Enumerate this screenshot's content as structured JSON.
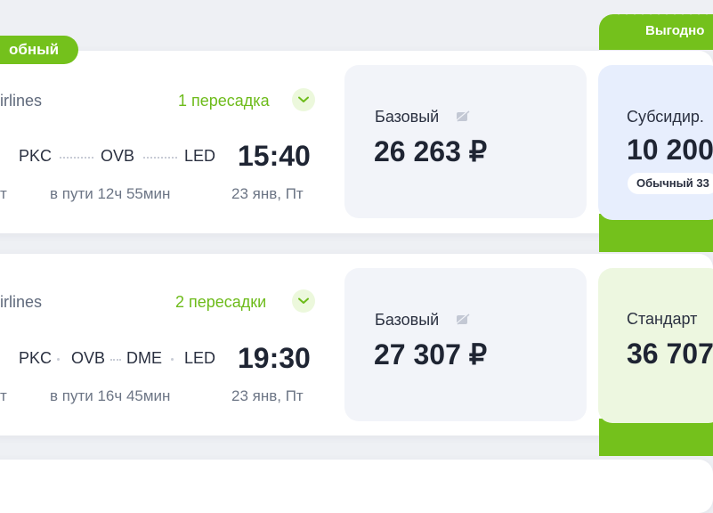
{
  "badge": {
    "label": "обный"
  },
  "ribbon": {
    "label": "Выгодно"
  },
  "tickets": [
    {
      "airline": "irlines",
      "transfers": "1 пересадка",
      "route": [
        "PKC",
        "OVB",
        "LED"
      ],
      "arrival_time": "15:40",
      "left_tail": "т",
      "duration": "в пути 12ч 55мин",
      "date": "23 янв, Пт",
      "fare": {
        "label": "Базовый",
        "price": "26 263 ₽"
      },
      "side_fare": {
        "label": "Субсидир.",
        "price": "10 200",
        "note": "Обычный 33"
      }
    },
    {
      "airline": "irlines",
      "transfers": "2 пересадки",
      "route": [
        "PKC",
        "OVB",
        "DME",
        "LED"
      ],
      "arrival_time": "19:30",
      "left_tail": "т",
      "duration": "в пути 16ч 45мин",
      "date": "23 янв, Пт",
      "fare": {
        "label": "Базовый",
        "price": "27 307 ₽"
      },
      "side_fare": {
        "label": "Стандарт",
        "price": "36 707"
      }
    }
  ],
  "colors": {
    "accent_green": "#74c11c",
    "transfer_green": "#6dbb1a",
    "subsidy_bg": "#e7eefd",
    "standard_bg": "#edf7e0"
  },
  "icons": {
    "expand": "chevron-down-icon",
    "fare_info": "no-baggage-icon"
  }
}
